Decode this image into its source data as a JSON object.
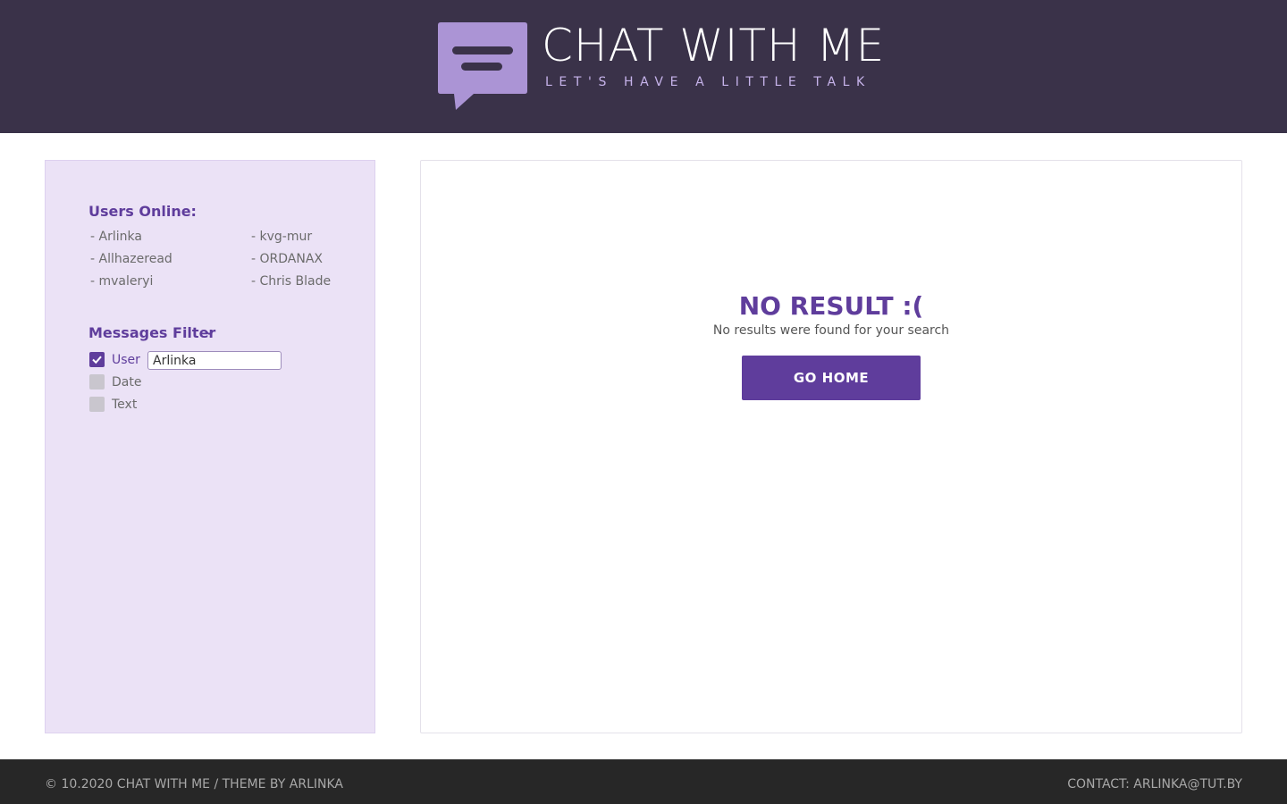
{
  "header": {
    "title": "CHAT WITH ME",
    "subtitle": "LET'S HAVE A LITTLE TALK",
    "logo_icon": "chat-bubble-icon"
  },
  "sidebar": {
    "users_title": "Users Online:",
    "users": [
      "- Arlinka",
      "- Allhazeread",
      "- mvaleryi",
      "- kvg-mur",
      "- ORDANAX",
      "- Chris Blade"
    ],
    "filter_title": "Messages Filter",
    "filter_chevron_icon": "chevron-down-icon",
    "filters": [
      {
        "label": "User",
        "checked": true
      },
      {
        "label": "Date",
        "checked": false
      },
      {
        "label": "Text",
        "checked": false
      }
    ],
    "user_filter_value": "Arlinka"
  },
  "main": {
    "title": "NO RESULT :(",
    "subtitle": "No results were found for your search",
    "button_label": "GO HOME"
  },
  "footer": {
    "left": "© 10.2020 CHAT WITH ME / THEME BY ARLINKA",
    "right": "CONTACT: ARLINKA@TUT.BY"
  },
  "colors": {
    "header_bg": "#3a3249",
    "accent": "#5f3d9c",
    "logo_bubble": "#ab94d5",
    "sidebar_bg": "#ebe2f6",
    "footer_bg": "#272727"
  }
}
